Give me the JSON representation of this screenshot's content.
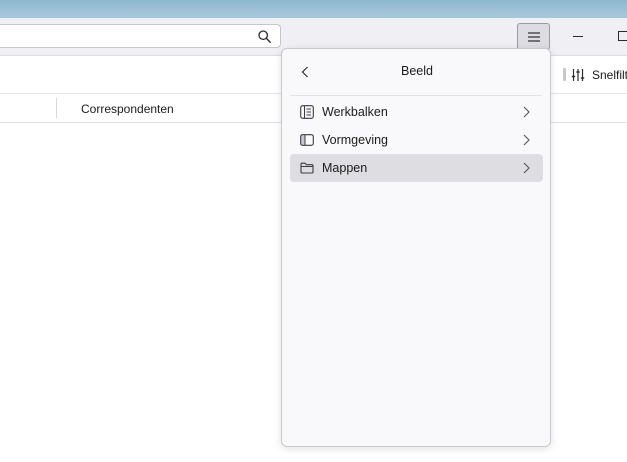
{
  "search": {
    "value": "",
    "placeholder": ""
  },
  "icons": {
    "search": "search-icon",
    "menu": "hamburger-menu-icon",
    "minimize": "minimize-icon",
    "maximize": "maximize-icon",
    "quick_filter": "filter-sliders-icon",
    "back": "chevron-left-icon",
    "toolbars": "toolbars-icon",
    "layout": "layout-icon",
    "folders": "folder-icon",
    "submenu": "chevron-right-icon"
  },
  "quickfilter": {
    "label": "Snelfilt"
  },
  "columns": {
    "correspondents": "Correspondenten"
  },
  "panel": {
    "title": "Beeld",
    "items": [
      {
        "label": "Werkbalken",
        "active": false
      },
      {
        "label": "Vormgeving",
        "active": false
      },
      {
        "label": "Mappen",
        "active": true
      }
    ]
  },
  "colors": {
    "titlebar": "#a9c8da",
    "toolbar_bg": "#f0f0f4",
    "panel_bg": "#f9f9fb",
    "hover_bg": "#dedee2"
  }
}
